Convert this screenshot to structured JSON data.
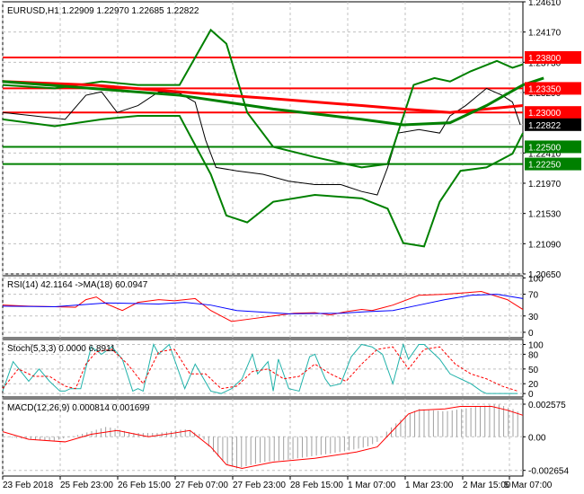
{
  "chart_data": [
    {
      "type": "line",
      "title": "EURUSD,H1  1.22909 1.22970 1.22685 1.22822",
      "ylim": [
        1.2065,
        1.2461
      ],
      "y_ticks": [
        "1.24610",
        "1.24170",
        "1.23730",
        "1.23290",
        "1.22410",
        "1.21970",
        "1.21530",
        "1.21090",
        "1.20650"
      ],
      "x_ticks": [
        "23 Feb 2018",
        "25 Feb 23:00",
        "26 Feb 15:00",
        "27 Feb 07:00",
        "27 Feb 23:00",
        "28 Feb 15:00",
        "1 Mar 07:00",
        "1 Mar 23:00",
        "2 Mar 15:00",
        "5 Mar 07:00"
      ],
      "x_range": [
        0,
        100
      ],
      "levels": [
        {
          "value": 1.238,
          "label": "1.23800",
          "color": "#ff0000"
        },
        {
          "value": 1.2335,
          "label": "1.23350",
          "color": "#ff0000"
        },
        {
          "value": 1.23,
          "label": "1.23000",
          "color": "#ff0000"
        },
        {
          "value": 1.22822,
          "label": "1.22822",
          "color": "#000000"
        },
        {
          "value": 1.225,
          "label": "1.22500",
          "color": "#008000"
        },
        {
          "value": 1.2225,
          "label": "1.22250",
          "color": "#008000"
        }
      ],
      "series": [
        {
          "name": "price",
          "color": "#000000",
          "x": [
            0,
            6,
            12,
            16,
            19,
            22,
            26,
            30,
            34,
            37,
            39,
            41,
            45,
            50,
            55,
            60,
            65,
            69,
            72,
            74,
            76,
            80,
            84,
            86,
            89,
            93,
            96,
            98,
            99.5
          ],
          "values": [
            1.23,
            1.2295,
            1.229,
            1.2325,
            1.233,
            1.23,
            1.231,
            1.233,
            1.2328,
            1.2315,
            1.226,
            1.222,
            1.2215,
            1.221,
            1.22,
            1.2195,
            1.2195,
            1.2185,
            1.218,
            1.222,
            1.227,
            1.2275,
            1.227,
            1.2295,
            1.231,
            1.2335,
            1.2325,
            1.2315,
            1.2282
          ]
        },
        {
          "name": "bb-upper",
          "color": "#008000",
          "x": [
            0,
            10,
            19,
            26,
            34,
            40,
            43,
            47,
            52,
            60,
            69,
            74,
            79,
            83,
            86,
            90,
            95,
            98,
            100
          ],
          "values": [
            1.234,
            1.2335,
            1.2345,
            1.234,
            1.234,
            1.242,
            1.24,
            1.23,
            1.225,
            1.2235,
            1.222,
            1.2225,
            1.234,
            1.235,
            1.2345,
            1.236,
            1.2375,
            1.2365,
            1.237
          ]
        },
        {
          "name": "bb-lower",
          "color": "#008000",
          "x": [
            0,
            10,
            19,
            26,
            34,
            40,
            43,
            47,
            52,
            60,
            69,
            74,
            77,
            81,
            84,
            88,
            93,
            98,
            100
          ],
          "values": [
            1.229,
            1.228,
            1.229,
            1.2295,
            1.2295,
            1.221,
            1.215,
            1.214,
            1.217,
            1.218,
            1.2175,
            1.216,
            1.211,
            1.2105,
            1.217,
            1.2215,
            1.222,
            1.224,
            1.227
          ]
        },
        {
          "name": "ma-red",
          "color": "#ff0000",
          "x": [
            0,
            17,
            34,
            52,
            69,
            77,
            86,
            93,
            100
          ],
          "values": [
            1.2345,
            1.234,
            1.233,
            1.232,
            1.231,
            1.2305,
            1.23,
            1.2305,
            1.231
          ]
        },
        {
          "name": "ma-green",
          "color": "#008000",
          "x": [
            0,
            17,
            34,
            52,
            69,
            77,
            86,
            93,
            100,
            104
          ],
          "values": [
            1.2345,
            1.2335,
            1.2325,
            1.2305,
            1.229,
            1.2282,
            1.2285,
            1.231,
            1.234,
            1.235
          ]
        }
      ]
    },
    {
      "type": "line",
      "title": "RSI(14) 42.1164  ->MA(18) 60.0947",
      "ylim": [
        0,
        100
      ],
      "y_ticks": [
        "100",
        "70",
        "30",
        "0"
      ],
      "series": [
        {
          "name": "rsi",
          "color": "#ff0000",
          "x": [
            0,
            5,
            10,
            14,
            16,
            18,
            20,
            23,
            26,
            30,
            33,
            37,
            40,
            44,
            48,
            52,
            56,
            60,
            63,
            66,
            69,
            71,
            73,
            75,
            80,
            85,
            88,
            92,
            95,
            97,
            100
          ],
          "values": [
            50,
            48,
            47,
            46,
            60,
            65,
            52,
            40,
            55,
            60,
            58,
            62,
            40,
            20,
            25,
            30,
            35,
            36,
            32,
            38,
            42,
            40,
            45,
            50,
            68,
            70,
            72,
            75,
            66,
            60,
            42
          ]
        },
        {
          "name": "rsi-ma",
          "color": "#0000ff",
          "x": [
            0,
            10,
            20,
            30,
            35,
            40,
            45,
            55,
            65,
            70,
            75,
            80,
            85,
            90,
            95,
            100
          ],
          "values": [
            48,
            47,
            54,
            52,
            55,
            50,
            40,
            34,
            35,
            38,
            40,
            50,
            60,
            68,
            70,
            62
          ]
        }
      ]
    },
    {
      "type": "line",
      "title": "Stoch(5,3,3) 0.0000 6.8911",
      "ylim": [
        0,
        100
      ],
      "y_ticks": [
        "100",
        "80",
        "50",
        "20",
        "0"
      ],
      "series": [
        {
          "name": "stoch-main",
          "color": "#20b2aa",
          "x": [
            0,
            2,
            5,
            7,
            9,
            11,
            12,
            13,
            15,
            17,
            19,
            21,
            23,
            25,
            26,
            27,
            29,
            30,
            32,
            33,
            35,
            37,
            40,
            42,
            44,
            46,
            48,
            49,
            51,
            52,
            53,
            55,
            57,
            59,
            60,
            62,
            63,
            65,
            67,
            69,
            71,
            73,
            75,
            77,
            78,
            80,
            81,
            84,
            86,
            88,
            90,
            92,
            93,
            95,
            97,
            99
          ],
          "values": [
            5,
            65,
            25,
            50,
            25,
            5,
            5,
            10,
            10,
            95,
            80,
            95,
            70,
            5,
            10,
            5,
            100,
            80,
            100,
            70,
            10,
            60,
            5,
            0,
            10,
            30,
            80,
            40,
            65,
            5,
            70,
            10,
            5,
            75,
            80,
            30,
            15,
            20,
            75,
            100,
            95,
            80,
            20,
            100,
            70,
            100,
            100,
            70,
            40,
            30,
            20,
            5,
            0,
            0,
            0,
            0
          ]
        },
        {
          "name": "stoch-signal",
          "color": "#ff0000",
          "x": [
            0,
            3,
            6,
            9,
            12,
            14,
            16,
            18,
            21,
            24,
            27,
            30,
            33,
            36,
            39,
            42,
            45,
            48,
            51,
            54,
            57,
            60,
            63,
            66,
            69,
            72,
            75,
            78,
            81,
            84,
            87,
            90,
            93,
            96,
            99
          ],
          "values": [
            10,
            50,
            35,
            35,
            15,
            10,
            60,
            85,
            90,
            60,
            20,
            85,
            90,
            40,
            40,
            10,
            15,
            45,
            50,
            30,
            35,
            60,
            40,
            25,
            60,
            90,
            95,
            50,
            90,
            95,
            60,
            40,
            30,
            15,
            5
          ]
        }
      ]
    },
    {
      "type": "bar",
      "title": "MACD(12,26,9) 0.000814 0.001699",
      "ylim": [
        -0.002654,
        0.002575
      ],
      "y_ticks": [
        "0.002575",
        "0.00",
        "-0.002654"
      ],
      "series": [
        {
          "name": "macd-histogram",
          "color": "#a0a0a0",
          "x": [
            0,
            5,
            10,
            15,
            20,
            25,
            30,
            35,
            38,
            40,
            43,
            45,
            50,
            55,
            60,
            65,
            70,
            72,
            74,
            76,
            78,
            80,
            85,
            90,
            95,
            98,
            100
          ],
          "values": [
            0,
            -0.0002,
            -0.0003,
            0.0002,
            0.0008,
            0.0003,
            0.0003,
            0.0006,
            0.0002,
            -0.001,
            -0.0022,
            -0.0025,
            -0.002,
            -0.0018,
            -0.0015,
            -0.0012,
            -0.0008,
            -0.0004,
            0.0005,
            0.0012,
            0.0018,
            0.0022,
            0.002,
            0.0023,
            0.0026,
            0.0022,
            0.0018
          ]
        },
        {
          "name": "macd-signal",
          "color": "#ff0000",
          "x": [
            0,
            5,
            12,
            17,
            22,
            28,
            33,
            36,
            40,
            43,
            46,
            52,
            60,
            68,
            72,
            75,
            78,
            80,
            85,
            88,
            91,
            94,
            97,
            100
          ],
          "values": [
            0.0004,
            -0.0002,
            -0.0004,
            0.0002,
            0.0005,
            0,
            0.0003,
            0.0005,
            -0.0008,
            -0.0022,
            -0.0025,
            -0.002,
            -0.0017,
            -0.0012,
            -0.0008,
            0.0005,
            0.0018,
            0.0021,
            0.0022,
            0.0024,
            0.0024,
            0.0024,
            0.0021,
            0.0017
          ]
        }
      ]
    }
  ]
}
